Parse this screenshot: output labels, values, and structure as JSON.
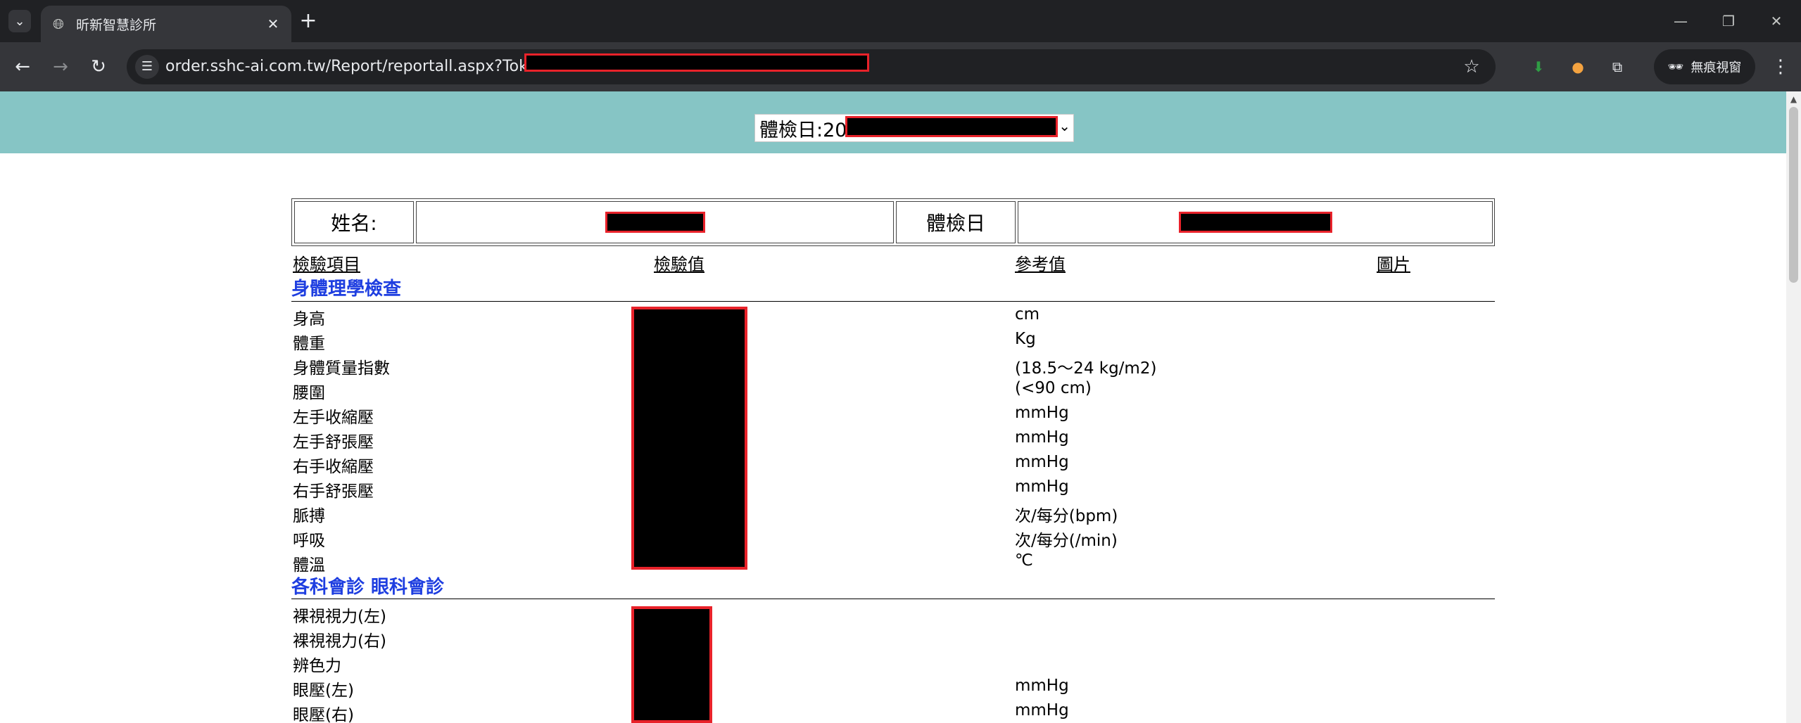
{
  "browser": {
    "tab_title": "昕新智慧診所",
    "url": "order.sshc-ai.com.tw/Report/reportall.aspx?Token=",
    "incognito_label": "無痕視窗"
  },
  "report": {
    "date_select_label": "體檢日:20",
    "info": {
      "name_label": "姓名:",
      "date_label": "體檢日"
    },
    "columns": {
      "item": "檢驗項目",
      "value": "檢驗值",
      "reference": "參考值",
      "image": "圖片"
    },
    "sections": [
      {
        "title": "身體理學檢查",
        "rows": [
          {
            "name": "身高",
            "ref": "cm"
          },
          {
            "name": "體重",
            "ref": "Kg"
          },
          {
            "name": "身體質量指數",
            "ref": "(18.5～24 kg/m2)"
          },
          {
            "name": "腰圍",
            "ref": "(<90 cm)"
          },
          {
            "name": "左手收縮壓",
            "ref": "mmHg"
          },
          {
            "name": "左手舒張壓",
            "ref": "mmHg"
          },
          {
            "name": "右手收縮壓",
            "ref": "mmHg"
          },
          {
            "name": "右手舒張壓",
            "ref": "mmHg"
          },
          {
            "name": "脈搏",
            "ref": "次/每分(bpm)"
          },
          {
            "name": "呼吸",
            "ref": "次/每分(/min)"
          },
          {
            "name": "體溫",
            "ref": "℃"
          }
        ]
      },
      {
        "title": "各科會診 眼科會診",
        "rows": [
          {
            "name": "裸視視力(左)",
            "ref": ""
          },
          {
            "name": "裸視視力(右)",
            "ref": ""
          },
          {
            "name": "辨色力",
            "ref": ""
          },
          {
            "name": "眼壓(左)",
            "ref": "mmHg"
          },
          {
            "name": "眼壓(右)",
            "ref": "mmHg"
          }
        ]
      }
    ]
  }
}
